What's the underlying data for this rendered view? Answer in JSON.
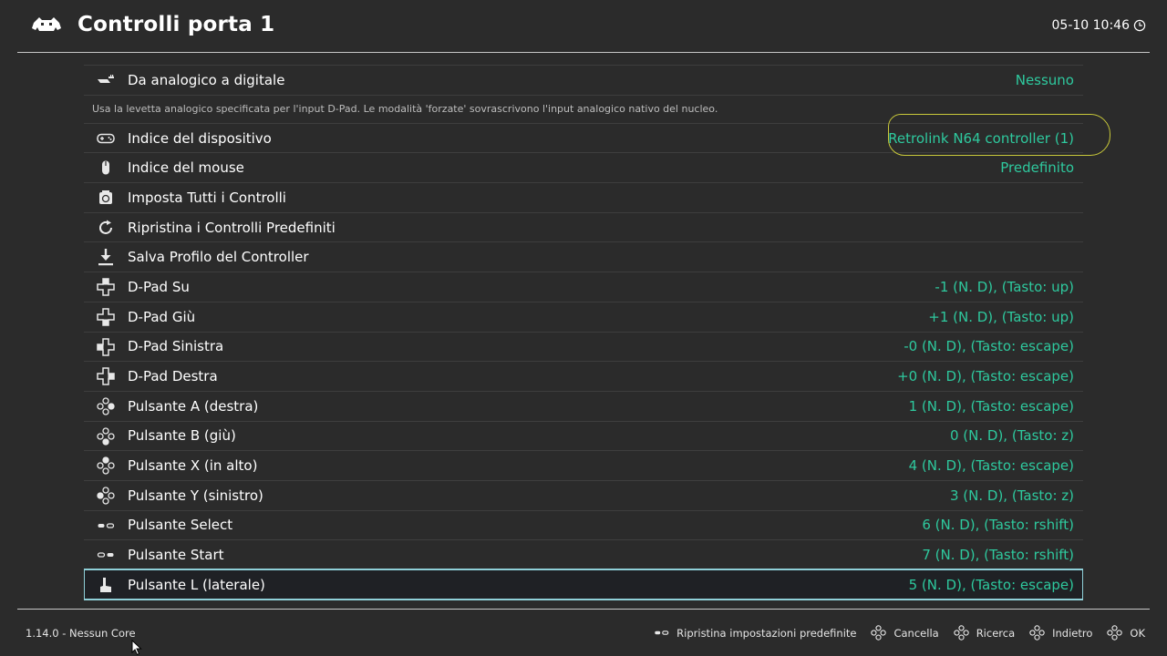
{
  "header": {
    "title": "Controlli porta 1",
    "clock": "05-10 10:46"
  },
  "rows": [
    {
      "icon": "analog-dpad-icon",
      "label": "Da analogico a digitale",
      "value": "Nessuno"
    },
    {
      "description": "Usa la levetta analogico specificata per l'input D-Pad. Le modalità 'forzate' sovrascrivono l'input analogico nativo del nucleo."
    },
    {
      "icon": "gamepad-icon",
      "label": "Indice del dispositivo",
      "value": "Retrolink N64 controller (1)"
    },
    {
      "icon": "mouse-icon",
      "label": "Indice del mouse",
      "value": "Predefinito"
    },
    {
      "icon": "bind-all-icon",
      "label": "Imposta Tutti i Controlli",
      "value": ""
    },
    {
      "icon": "reload-icon",
      "label": "Ripristina i Controlli Predefiniti",
      "value": ""
    },
    {
      "icon": "download-icon",
      "label": "Salva Profilo del Controller",
      "value": ""
    },
    {
      "icon": "dpad-up-icon",
      "label": "D-Pad Su",
      "value": "-1 (N. D), (Tasto: up)"
    },
    {
      "icon": "dpad-down-icon",
      "label": "D-Pad Giù",
      "value": "+1 (N. D), (Tasto: up)"
    },
    {
      "icon": "dpad-left-icon",
      "label": "D-Pad Sinistra",
      "value": "-0 (N. D), (Tasto: escape)"
    },
    {
      "icon": "dpad-right-icon",
      "label": "D-Pad Destra",
      "value": "+0 (N. D), (Tasto: escape)"
    },
    {
      "icon": "button-right-icon",
      "label": "Pulsante A (destra)",
      "value": "1 (N. D), (Tasto: escape)"
    },
    {
      "icon": "button-down-icon",
      "label": "Pulsante B (giù)",
      "value": "0 (N. D), (Tasto: z)"
    },
    {
      "icon": "button-up-icon",
      "label": "Pulsante X (in alto)",
      "value": "4 (N. D), (Tasto: escape)"
    },
    {
      "icon": "button-left-icon",
      "label": "Pulsante Y (sinistro)",
      "value": "3 (N. D), (Tasto: z)"
    },
    {
      "icon": "select-icon",
      "label": "Pulsante Select",
      "value": "6 (N. D), (Tasto: rshift)"
    },
    {
      "icon": "start-icon",
      "label": "Pulsante Start",
      "value": "7 (N. D), (Tasto: rshift)"
    },
    {
      "icon": "shoulder-l-icon",
      "label": "Pulsante L (laterale)",
      "value": "5 (N. D), (Tasto: escape)",
      "selected": true
    }
  ],
  "footer": {
    "version": "1.14.0 - Nessun Core",
    "hints": [
      {
        "icon": "select-button-icon",
        "label": "Ripristina impostazioni predefinite"
      },
      {
        "icon": "face-buttons-icon",
        "label": "Cancella"
      },
      {
        "icon": "face-buttons-icon",
        "label": "Ricerca"
      },
      {
        "icon": "face-buttons-icon",
        "label": "Indietro"
      },
      {
        "icon": "face-buttons-icon",
        "label": "OK"
      }
    ]
  },
  "colors": {
    "background": "#2b2b2b",
    "value": "#2ec99e",
    "selection": "#8fd0d8",
    "annotation": "#c9c93a"
  }
}
